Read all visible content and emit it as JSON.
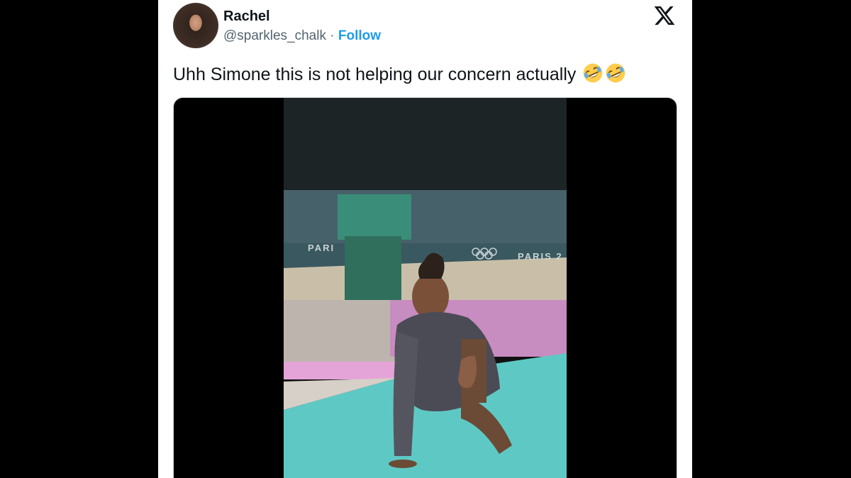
{
  "tweet": {
    "author_name": "Rachel",
    "handle": "@sparkles_chalk",
    "separator": "·",
    "follow_label": "Follow",
    "text": "Uhh Simone this is not helping our concern actually",
    "emojis": [
      "rolling-on-floor-laughing",
      "rolling-on-floor-laughing"
    ]
  },
  "media": {
    "signage_left": "PARI",
    "signage_right": "PARIS 2"
  },
  "colors": {
    "follow": "#1d9bf0",
    "text": "#0f1419",
    "secondary": "#536471",
    "floor": "#5ec9c4",
    "mat_pink": "#e5a4d8",
    "post_green": "#2f6f5c"
  }
}
